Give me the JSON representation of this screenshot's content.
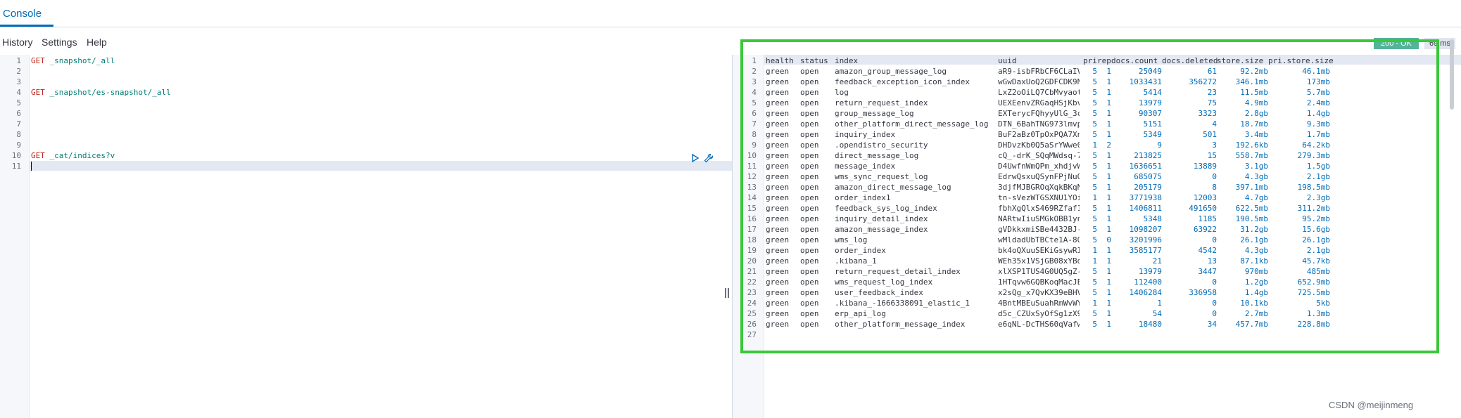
{
  "tabs": {
    "console_label": "Console"
  },
  "toolbar": {
    "history_label": "History",
    "settings_label": "Settings",
    "help_label": "Help"
  },
  "editor": {
    "line_numbers": [
      "1",
      "2",
      "3",
      "4",
      "5",
      "6",
      "7",
      "8",
      "9",
      "10",
      "11"
    ],
    "requests": [
      {
        "method": "GET",
        "path": "_snapshot/_all"
      },
      {
        "method": "GET",
        "path": "_snapshot/es-snapshot/_all"
      },
      {
        "method": "GET",
        "path": "_cat/indices?v"
      }
    ]
  },
  "response": {
    "status": "200 - OK",
    "time": "69 ms",
    "line_numbers": [
      "1",
      "2",
      "3",
      "4",
      "5",
      "6",
      "7",
      "8",
      "9",
      "10",
      "11",
      "12",
      "13",
      "14",
      "15",
      "16",
      "17",
      "18",
      "19",
      "20",
      "21",
      "22",
      "23",
      "24",
      "25",
      "26",
      "27"
    ],
    "columns": [
      "health",
      "status",
      "index",
      "uuid",
      "pri",
      "rep",
      "docs.count",
      "docs.deleted",
      "store.size",
      "pri.store.size"
    ],
    "rows": [
      [
        "green",
        "open",
        "amazon_group_message_log",
        "aR9-isbFRbCF6CLaIVsRQg",
        "5",
        "1",
        "25049",
        "61",
        "92.2mb",
        "46.1mb"
      ],
      [
        "green",
        "open",
        "feedback_exception_icon_index",
        "wGwDaxUoQ2GDFCDK9NIbog",
        "5",
        "1",
        "1033431",
        "356272",
        "346.1mb",
        "173mb"
      ],
      [
        "green",
        "open",
        "log",
        "LxZ2oOiLQ7CbMvyaotc6mw",
        "5",
        "1",
        "5414",
        "23",
        "11.5mb",
        "5.7mb"
      ],
      [
        "green",
        "open",
        "return_request_index",
        "UEXEenvZRGaqHSjKbvcUUA",
        "5",
        "1",
        "13979",
        "75",
        "4.9mb",
        "2.4mb"
      ],
      [
        "green",
        "open",
        "group_message_log",
        "EXTerycFQhyyUlG_3cMKkg",
        "5",
        "1",
        "90307",
        "3323",
        "2.8gb",
        "1.4gb"
      ],
      [
        "green",
        "open",
        "other_platform_direct_message_log",
        "DTN_6BahTNG973lmvpku1w",
        "5",
        "1",
        "5151",
        "4",
        "18.7mb",
        "9.3mb"
      ],
      [
        "green",
        "open",
        "inquiry_index",
        "BuF2aBz0TpOxPQA7Xn_kAw",
        "5",
        "1",
        "5349",
        "501",
        "3.4mb",
        "1.7mb"
      ],
      [
        "green",
        "open",
        ".opendistro_security",
        "DHDvzKb0Q5aSrYWwe0bA3A",
        "1",
        "2",
        "9",
        "3",
        "192.6kb",
        "64.2kb"
      ],
      [
        "green",
        "open",
        "direct_message_log",
        "cQ_-drK_SQqMWdsq-7PTdg",
        "5",
        "1",
        "213825",
        "15",
        "558.7mb",
        "279.3mb"
      ],
      [
        "green",
        "open",
        "message_index",
        "D4UwfnWmQPm_xhdjvWenmQ",
        "5",
        "1",
        "1636651",
        "13889",
        "3.1gb",
        "1.5gb"
      ],
      [
        "green",
        "open",
        "wms_sync_request_log",
        "EdrwQsxuQSynFPjNuO_bHQ",
        "5",
        "1",
        "685075",
        "0",
        "4.3gb",
        "2.1gb"
      ],
      [
        "green",
        "open",
        "amazon_direct_message_log",
        "3djfMJBGROqXqkBKqNJXNw",
        "5",
        "1",
        "205179",
        "8",
        "397.1mb",
        "198.5mb"
      ],
      [
        "green",
        "open",
        "order_index1",
        "tn-sVezWTGSXNU1YOiQIBw",
        "1",
        "1",
        "3771938",
        "12003",
        "4.7gb",
        "2.3gb"
      ],
      [
        "green",
        "open",
        "feedback_sys_log_index",
        "fbhXgQlxS469RZfaf1dpcw",
        "5",
        "1",
        "1406811",
        "491650",
        "622.5mb",
        "311.2mb"
      ],
      [
        "green",
        "open",
        "inquiry_detail_index",
        "NARtwIiuSMGkOBB1yn55lg",
        "5",
        "1",
        "5348",
        "1185",
        "190.5mb",
        "95.2mb"
      ],
      [
        "green",
        "open",
        "amazon_message_index",
        "gVDkkxmiSBe4432BJ-J5Zg",
        "5",
        "1",
        "1098207",
        "63922",
        "31.2gb",
        "15.6gb"
      ],
      [
        "green",
        "open",
        "wms_log",
        "wMldadUbTBCte1A-8Om8dA",
        "5",
        "0",
        "3201996",
        "0",
        "26.1gb",
        "26.1gb"
      ],
      [
        "green",
        "open",
        "order_index",
        "bk4oQXuuSEKiGsywRISFeQ",
        "1",
        "1",
        "3585177",
        "4542",
        "4.3gb",
        "2.1gb"
      ],
      [
        "green",
        "open",
        ".kibana_1",
        "WEh35x1VSjGB08xYBdmTCg",
        "1",
        "1",
        "21",
        "13",
        "87.1kb",
        "45.7kb"
      ],
      [
        "green",
        "open",
        "return_request_detail_index",
        "xlXSP1TUS4G0UQ5gZ-sRIA",
        "5",
        "1",
        "13979",
        "3447",
        "970mb",
        "485mb"
      ],
      [
        "green",
        "open",
        "wms_request_log_index",
        "1HTqvw6GQBKoqMacJEzNFw",
        "5",
        "1",
        "112400",
        "0",
        "1.2gb",
        "652.9mb"
      ],
      [
        "green",
        "open",
        "user_feedback_index",
        "x2sQg_x7QvKX39eBHV6x4w",
        "5",
        "1",
        "1406284",
        "336958",
        "1.4gb",
        "725.5mb"
      ],
      [
        "green",
        "open",
        ".kibana_-1666338091_elastic_1",
        "4BntMBEuSuahRmWvWYfdhA",
        "1",
        "1",
        "1",
        "0",
        "10.1kb",
        "5kb"
      ],
      [
        "green",
        "open",
        "erp_api_log",
        "d5c_CZUxSyOfSg1zX92OeQ",
        "5",
        "1",
        "54",
        "0",
        "2.7mb",
        "1.3mb"
      ],
      [
        "green",
        "open",
        "other_platform_message_index",
        "e6qNL-DcTHS60qVafwg7Aw",
        "5",
        "1",
        "18480",
        "34",
        "457.7mb",
        "228.8mb"
      ]
    ]
  },
  "watermark": "CSDN @meijinmeng",
  "colors": {
    "accent": "#006bb8",
    "ok_badge": "#54b399",
    "highlight_box": "#39c839",
    "method": "#bd271e",
    "path": "#017d73"
  }
}
